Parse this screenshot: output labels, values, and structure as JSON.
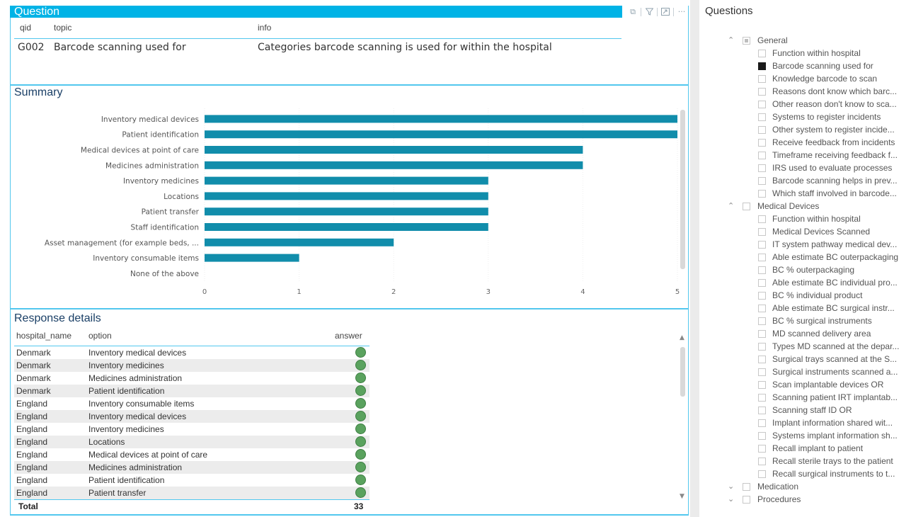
{
  "question": {
    "title": "Question",
    "columns": {
      "qid": "qid",
      "topic": "topic",
      "info": "info"
    },
    "row": {
      "qid": "G002",
      "topic": "Barcode scanning used for",
      "info": "Categories barcode scanning is used for within the hospital"
    }
  },
  "summary": {
    "title": "Summary"
  },
  "chart_data": {
    "type": "bar",
    "orientation": "horizontal",
    "categories": [
      "Inventory medical devices",
      "Patient identification",
      "Medical devices at point of care",
      "Medicines administration",
      "Inventory medicines",
      "Locations",
      "Patient transfer",
      "Staff identification",
      "Asset management (for example beds, ...",
      "Inventory consumable items",
      "None of the above"
    ],
    "values": [
      5,
      5,
      4,
      4,
      3,
      3,
      3,
      3,
      2,
      1,
      0
    ],
    "xticks": [
      "0",
      "1",
      "2",
      "3",
      "4",
      "5"
    ],
    "xlim": [
      0,
      5
    ],
    "bar_color": "#118dab",
    "grid": true
  },
  "response": {
    "title": "Response details",
    "columns": {
      "hospital": "hospital_name",
      "option": "option",
      "answer": "answer"
    },
    "rows": [
      {
        "hospital": "Denmark",
        "option": "Inventory medical devices"
      },
      {
        "hospital": "Denmark",
        "option": "Inventory medicines"
      },
      {
        "hospital": "Denmark",
        "option": "Medicines administration"
      },
      {
        "hospital": "Denmark",
        "option": "Patient identification"
      },
      {
        "hospital": "England",
        "option": "Inventory consumable items"
      },
      {
        "hospital": "England",
        "option": "Inventory medical devices"
      },
      {
        "hospital": "England",
        "option": "Inventory medicines"
      },
      {
        "hospital": "England",
        "option": "Locations"
      },
      {
        "hospital": "England",
        "option": "Medical devices at point of care"
      },
      {
        "hospital": "England",
        "option": "Medicines administration"
      },
      {
        "hospital": "England",
        "option": "Patient identification"
      },
      {
        "hospital": "England",
        "option": "Patient transfer"
      }
    ],
    "total_label": "Total",
    "total_value": "33",
    "answer_color": "#5aa25e"
  },
  "slicer": {
    "title": "Questions",
    "groups": [
      {
        "label": "General",
        "expanded": true,
        "state": "partial",
        "items": [
          {
            "label": "Function within hospital",
            "checked": false
          },
          {
            "label": "Barcode scanning used for",
            "checked": true
          },
          {
            "label": "Knowledge barcode to scan",
            "checked": false
          },
          {
            "label": "Reasons dont know which barc...",
            "checked": false
          },
          {
            "label": "Other reason don't know to sca...",
            "checked": false
          },
          {
            "label": "Systems to register incidents",
            "checked": false
          },
          {
            "label": "Other system to register incide...",
            "checked": false
          },
          {
            "label": "Receive feedback from incidents",
            "checked": false
          },
          {
            "label": "Timeframe receiving feedback f...",
            "checked": false
          },
          {
            "label": "IRS used to evaluate processes",
            "checked": false
          },
          {
            "label": "Barcode scanning helps in prev...",
            "checked": false
          },
          {
            "label": "Which staff involved in barcode...",
            "checked": false
          }
        ]
      },
      {
        "label": "Medical Devices",
        "expanded": true,
        "state": "none",
        "items": [
          {
            "label": "Function within hospital",
            "checked": false
          },
          {
            "label": "Medical Devices Scanned",
            "checked": false
          },
          {
            "label": "IT system pathway medical dev...",
            "checked": false
          },
          {
            "label": "Able estimate BC outerpackaging",
            "checked": false
          },
          {
            "label": "BC % outerpackaging",
            "checked": false
          },
          {
            "label": "Able estimate BC individual pro...",
            "checked": false
          },
          {
            "label": "BC % individual product",
            "checked": false
          },
          {
            "label": "Able estimate BC surgical instr...",
            "checked": false
          },
          {
            "label": "BC % surgical instruments",
            "checked": false
          },
          {
            "label": "MD scanned delivery area",
            "checked": false
          },
          {
            "label": "Types MD scanned at the depar...",
            "checked": false
          },
          {
            "label": "Surgical trays scanned at the S...",
            "checked": false
          },
          {
            "label": "Surgical instruments scanned a...",
            "checked": false
          },
          {
            "label": "Scan implantable devices OR",
            "checked": false
          },
          {
            "label": "Scanning patient IRT implantab...",
            "checked": false
          },
          {
            "label": "Scanning staff ID OR",
            "checked": false
          },
          {
            "label": "Implant information shared wit...",
            "checked": false
          },
          {
            "label": "Systems implant information sh...",
            "checked": false
          },
          {
            "label": "Recall implant to patient",
            "checked": false
          },
          {
            "label": "Recall sterile trays to the patient",
            "checked": false
          },
          {
            "label": "Recall surgical instruments to t...",
            "checked": false
          }
        ]
      },
      {
        "label": "Medication",
        "expanded": false,
        "state": "none",
        "items": []
      },
      {
        "label": "Procedures",
        "expanded": false,
        "state": "none",
        "items": []
      }
    ]
  },
  "icons": {
    "copy": "copy-icon",
    "filter": "filter-icon",
    "focus": "focus-mode-icon",
    "more": "more-options-icon"
  }
}
